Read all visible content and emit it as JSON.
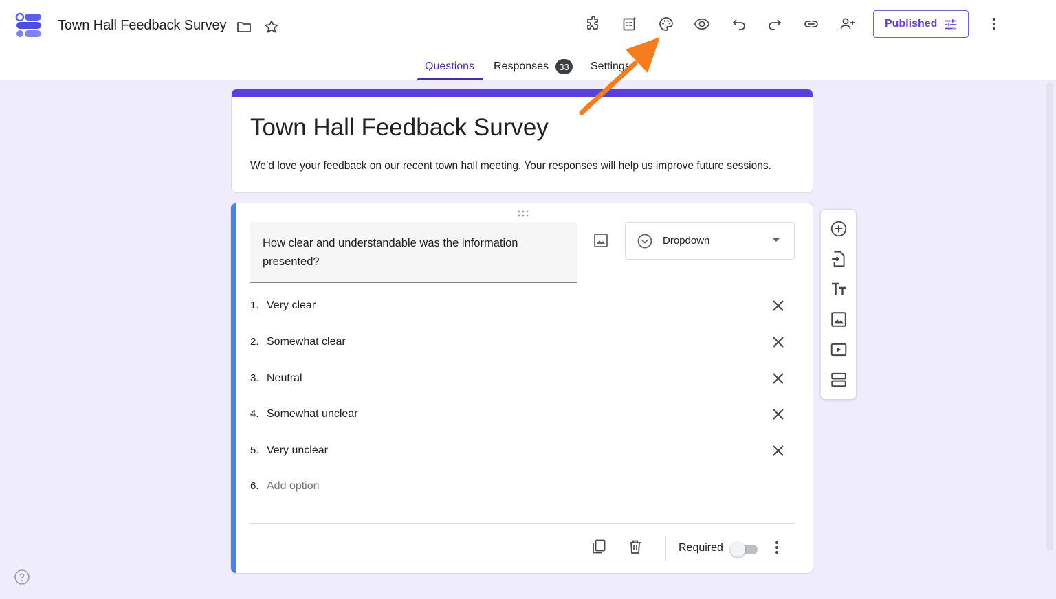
{
  "header": {
    "doc_title": "Town Hall Feedback Survey",
    "publish_label": "Published"
  },
  "tabs": [
    {
      "label": "Questions",
      "active": true
    },
    {
      "label": "Responses",
      "badge": "33"
    },
    {
      "label": "Settings"
    }
  ],
  "toolbar_icons": [
    "add-ons-icon",
    "ai-form-icon",
    "palette-icon",
    "preview-eye-icon",
    "undo-icon",
    "redo-icon",
    "link-icon",
    "add-collaborator-icon",
    "more-vert-icon"
  ],
  "form": {
    "title": "Town Hall Feedback Survey",
    "description": "We’d love your feedback on our recent town hall meeting. Your responses will help us improve future sessions."
  },
  "question": {
    "text": "How clear and understandable was the information presented?",
    "type": "Dropdown",
    "options": [
      {
        "num": "1.",
        "label": "Very clear"
      },
      {
        "num": "2.",
        "label": "Somewhat clear"
      },
      {
        "num": "3.",
        "label": "Neutral"
      },
      {
        "num": "4.",
        "label": "Somewhat unclear"
      },
      {
        "num": "5.",
        "label": "Very unclear"
      }
    ],
    "add_option": {
      "num": "6.",
      "label": "Add option"
    },
    "required_label": "Required",
    "required": false
  },
  "side_toolbar_icons": [
    "add-question-icon",
    "import-questions-icon",
    "add-title-icon",
    "add-image-icon",
    "add-video-icon",
    "add-section-icon"
  ],
  "colors": {
    "accent": "#5b3fd9",
    "publish": "#6a3fc7",
    "question_accent": "#4285f4",
    "background": "#efedfb",
    "annotation_arrow": "#f57c1f"
  }
}
